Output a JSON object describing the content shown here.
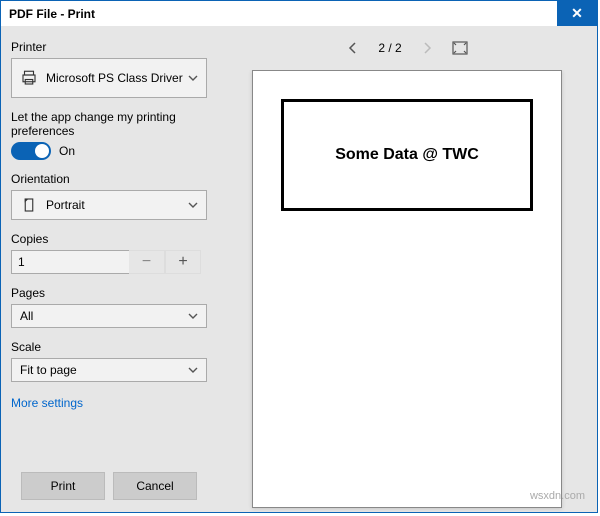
{
  "title": "PDF File - Print",
  "close": "✕",
  "printer": {
    "label": "Printer",
    "selected": "Microsoft PS Class Driver"
  },
  "prefs": {
    "text": "Let the app change my printing preferences",
    "state": "On"
  },
  "orientation": {
    "label": "Orientation",
    "selected": "Portrait"
  },
  "copies": {
    "label": "Copies",
    "value": "1"
  },
  "pages": {
    "label": "Pages",
    "selected": "All"
  },
  "scale": {
    "label": "Scale",
    "selected": "Fit to page"
  },
  "more_link": "More settings",
  "buttons": {
    "print": "Print",
    "cancel": "Cancel"
  },
  "nav": {
    "counter": "2 / 2"
  },
  "preview": {
    "content": "Some Data @ TWC"
  },
  "watermark": "wsxdn.com"
}
